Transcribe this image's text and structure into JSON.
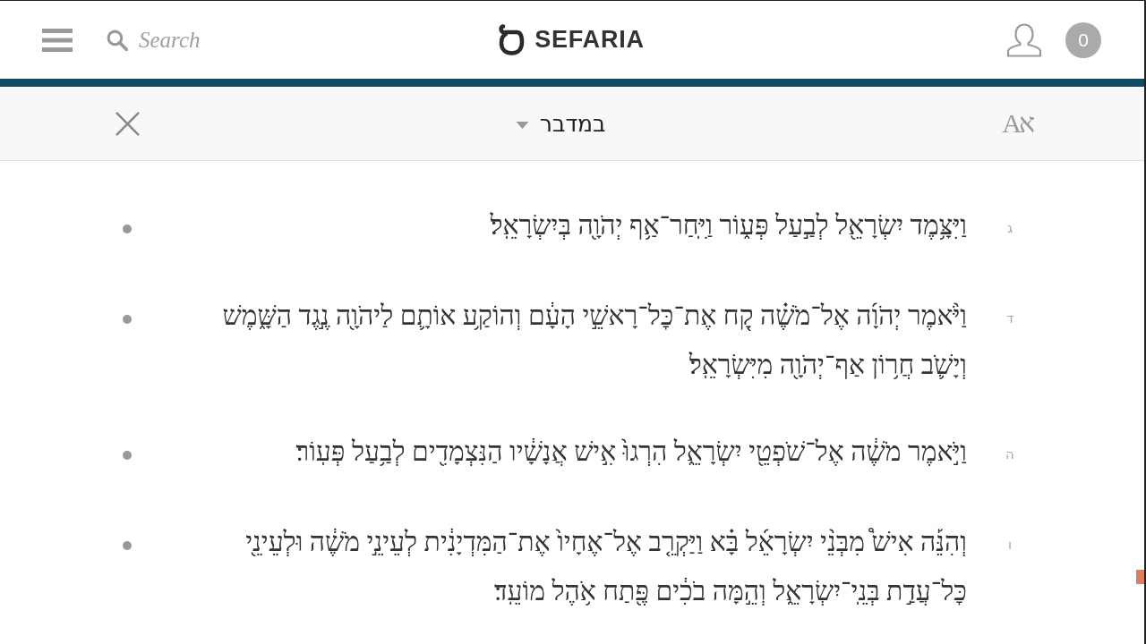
{
  "header": {
    "search": {
      "placeholder": "Search"
    },
    "logo": {
      "text": "SEFARIA"
    },
    "notifications": {
      "count": "0"
    }
  },
  "toolbar": {
    "title": "במדבר",
    "language_toggle": {
      "label": "Aא"
    }
  },
  "verses": [
    {
      "number": "ג",
      "text": "וַיִּצָּ֥מֶד יִשְׂרָאֵ֖ל לְבַ֣עַל פְּע֑וֹר וַיִּֽחַר־אַ֥ף יְהֹוָ֖ה בְּיִשְׂרָאֵֽל׃"
    },
    {
      "number": "ד",
      "text": "וַיֹּ֨אמֶר יְהֹוָ֜ה אֶל־מֹשֶׁ֗ה קַ֚ח אֶת־כׇּל־רָאשֵׁ֣י הָעָ֔ם וְהוֹקַ֥ע אוֹתָ֛ם לַיהֹוָ֖ה נֶ֣גֶד הַשָּׁ֑מֶשׁ וְיָשֹׁ֛ב חֲר֥וֹן אַף־יְהֹוָ֖ה מִיִּשְׂרָאֵֽל׃"
    },
    {
      "number": "ה",
      "text": "וַיֹּ֣אמֶר מֹשֶׁ֔ה אֶל־שֹׁפְטֵ֖י יִשְׂרָאֵ֑ל הִרְגוּ֙ אִ֣ישׁ אֲנָשָׁ֔יו הַנִּצְמָדִ֖ים לְבַ֥עַל פְּעֽוֹר׃"
    },
    {
      "number": "ו",
      "text": "וְהִנֵּ֡ה אִישׁ֩ מִבְּנֵ֨י יִשְׂרָאֵ֜ל בָּ֗א וַיַּקְרֵ֤ב אֶל־אֶחָיו֙ אֶת־הַמִּדְיָנִ֔ית לְעֵינֵ֣י מֹשֶׁ֔ה וּלְעֵינֵ֖י כׇּל־עֲדַ֣ת בְּנֵֽי־יִשְׂרָאֵ֑ל וְהֵ֣מָּה בֹכִ֔ים פֶּ֖תַח אֹ֥הֶל מוֹעֵֽד׃"
    }
  ]
}
